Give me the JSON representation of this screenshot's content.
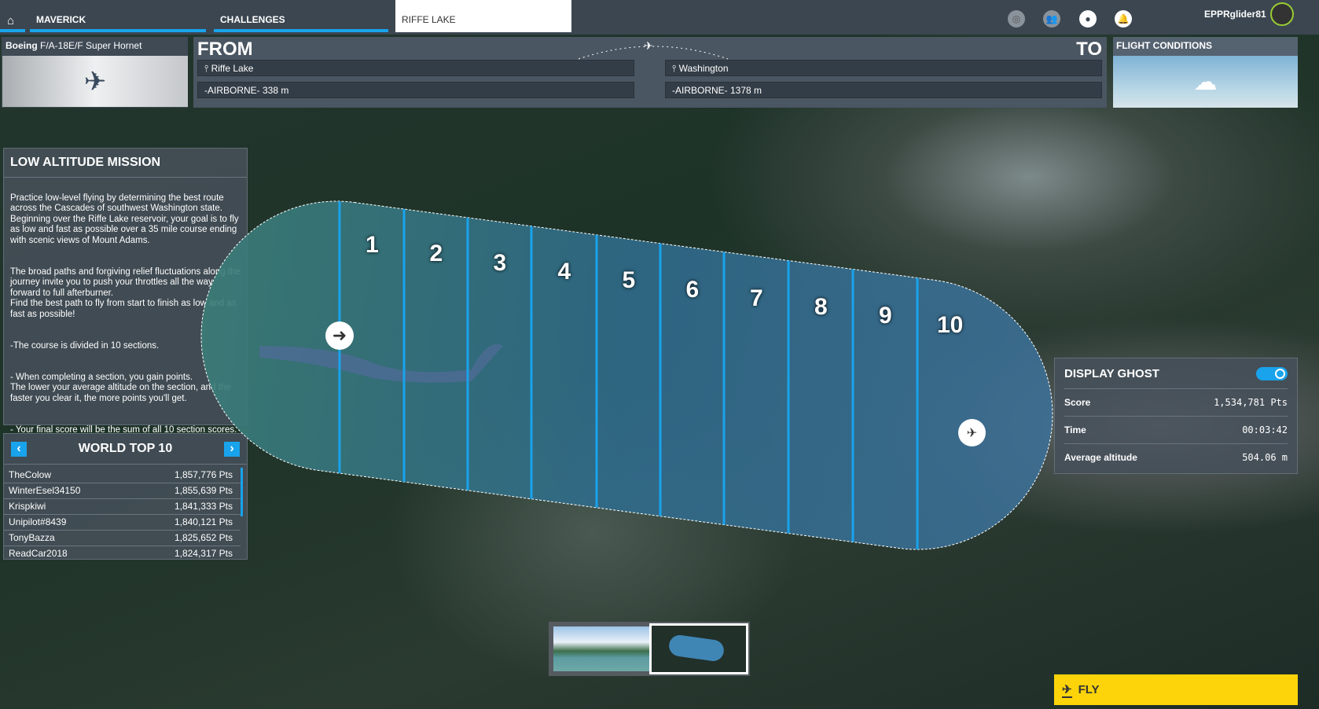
{
  "tabs": {
    "maverick": "MAVERICK",
    "challenges": "CHALLENGES",
    "current": "RIFFE LAKE"
  },
  "user": {
    "name": "EPPRglider81"
  },
  "aircraft": {
    "brand": "Boeing",
    "model": "F/A-18E/F Super Hornet"
  },
  "from": {
    "label": "FROM",
    "location": "Riffe Lake",
    "altitude": "-AIRBORNE- 338 m"
  },
  "to": {
    "label": "TO",
    "location": "Washington",
    "altitude": "-AIRBORNE- 1378 m"
  },
  "conditions": {
    "title": "FLIGHT CONDITIONS"
  },
  "mission": {
    "title": "LOW ALTITUDE MISSION",
    "paragraphs": [
      "Practice low-level flying by determining the best route across the Cascades of southwest Washington state. Beginning over the Riffe Lake reservoir, your goal is to fly as low and fast as possible over a 35 mile course ending with scenic views of Mount Adams.",
      "The broad paths and forgiving relief fluctuations along the journey invite you to push your throttles all the way forward to full afterburner.\nFind the best path to fly from start to finish as low and as fast as possible!",
      "-The course is divided in 10 sections.",
      "- When completing a section, you gain points.\nThe lower your average altitude on the section, and the faster you clear it, the more points you'll get.",
      "- Your final score will be the sum of all 10 section scores."
    ]
  },
  "leaderboard": {
    "title": "WORLD TOP 10",
    "rows": [
      {
        "name": "TheColow",
        "score": "1,857,776 Pts"
      },
      {
        "name": "WinterEsel34150",
        "score": "1,855,639 Pts"
      },
      {
        "name": "Krispkiwi",
        "score": "1,841,333 Pts"
      },
      {
        "name": "Unipilot#8439",
        "score": "1,840,121 Pts"
      },
      {
        "name": "TonyBazza",
        "score": "1,825,652 Pts"
      },
      {
        "name": "ReadCar2018",
        "score": "1,824,317 Pts"
      }
    ]
  },
  "sections": [
    "1",
    "2",
    "3",
    "4",
    "5",
    "6",
    "7",
    "8",
    "9",
    "10"
  ],
  "ghost": {
    "title": "DISPLAY GHOST",
    "enabled": true,
    "score_label": "Score",
    "score": "1,534,781 Pts",
    "time_label": "Time",
    "time": "00:03:42",
    "alt_label": "Average altitude",
    "alt": "504.06 m"
  },
  "fly": {
    "label": "FLY"
  },
  "colors": {
    "accent": "#19a3ec",
    "fly": "#fdd40a"
  }
}
